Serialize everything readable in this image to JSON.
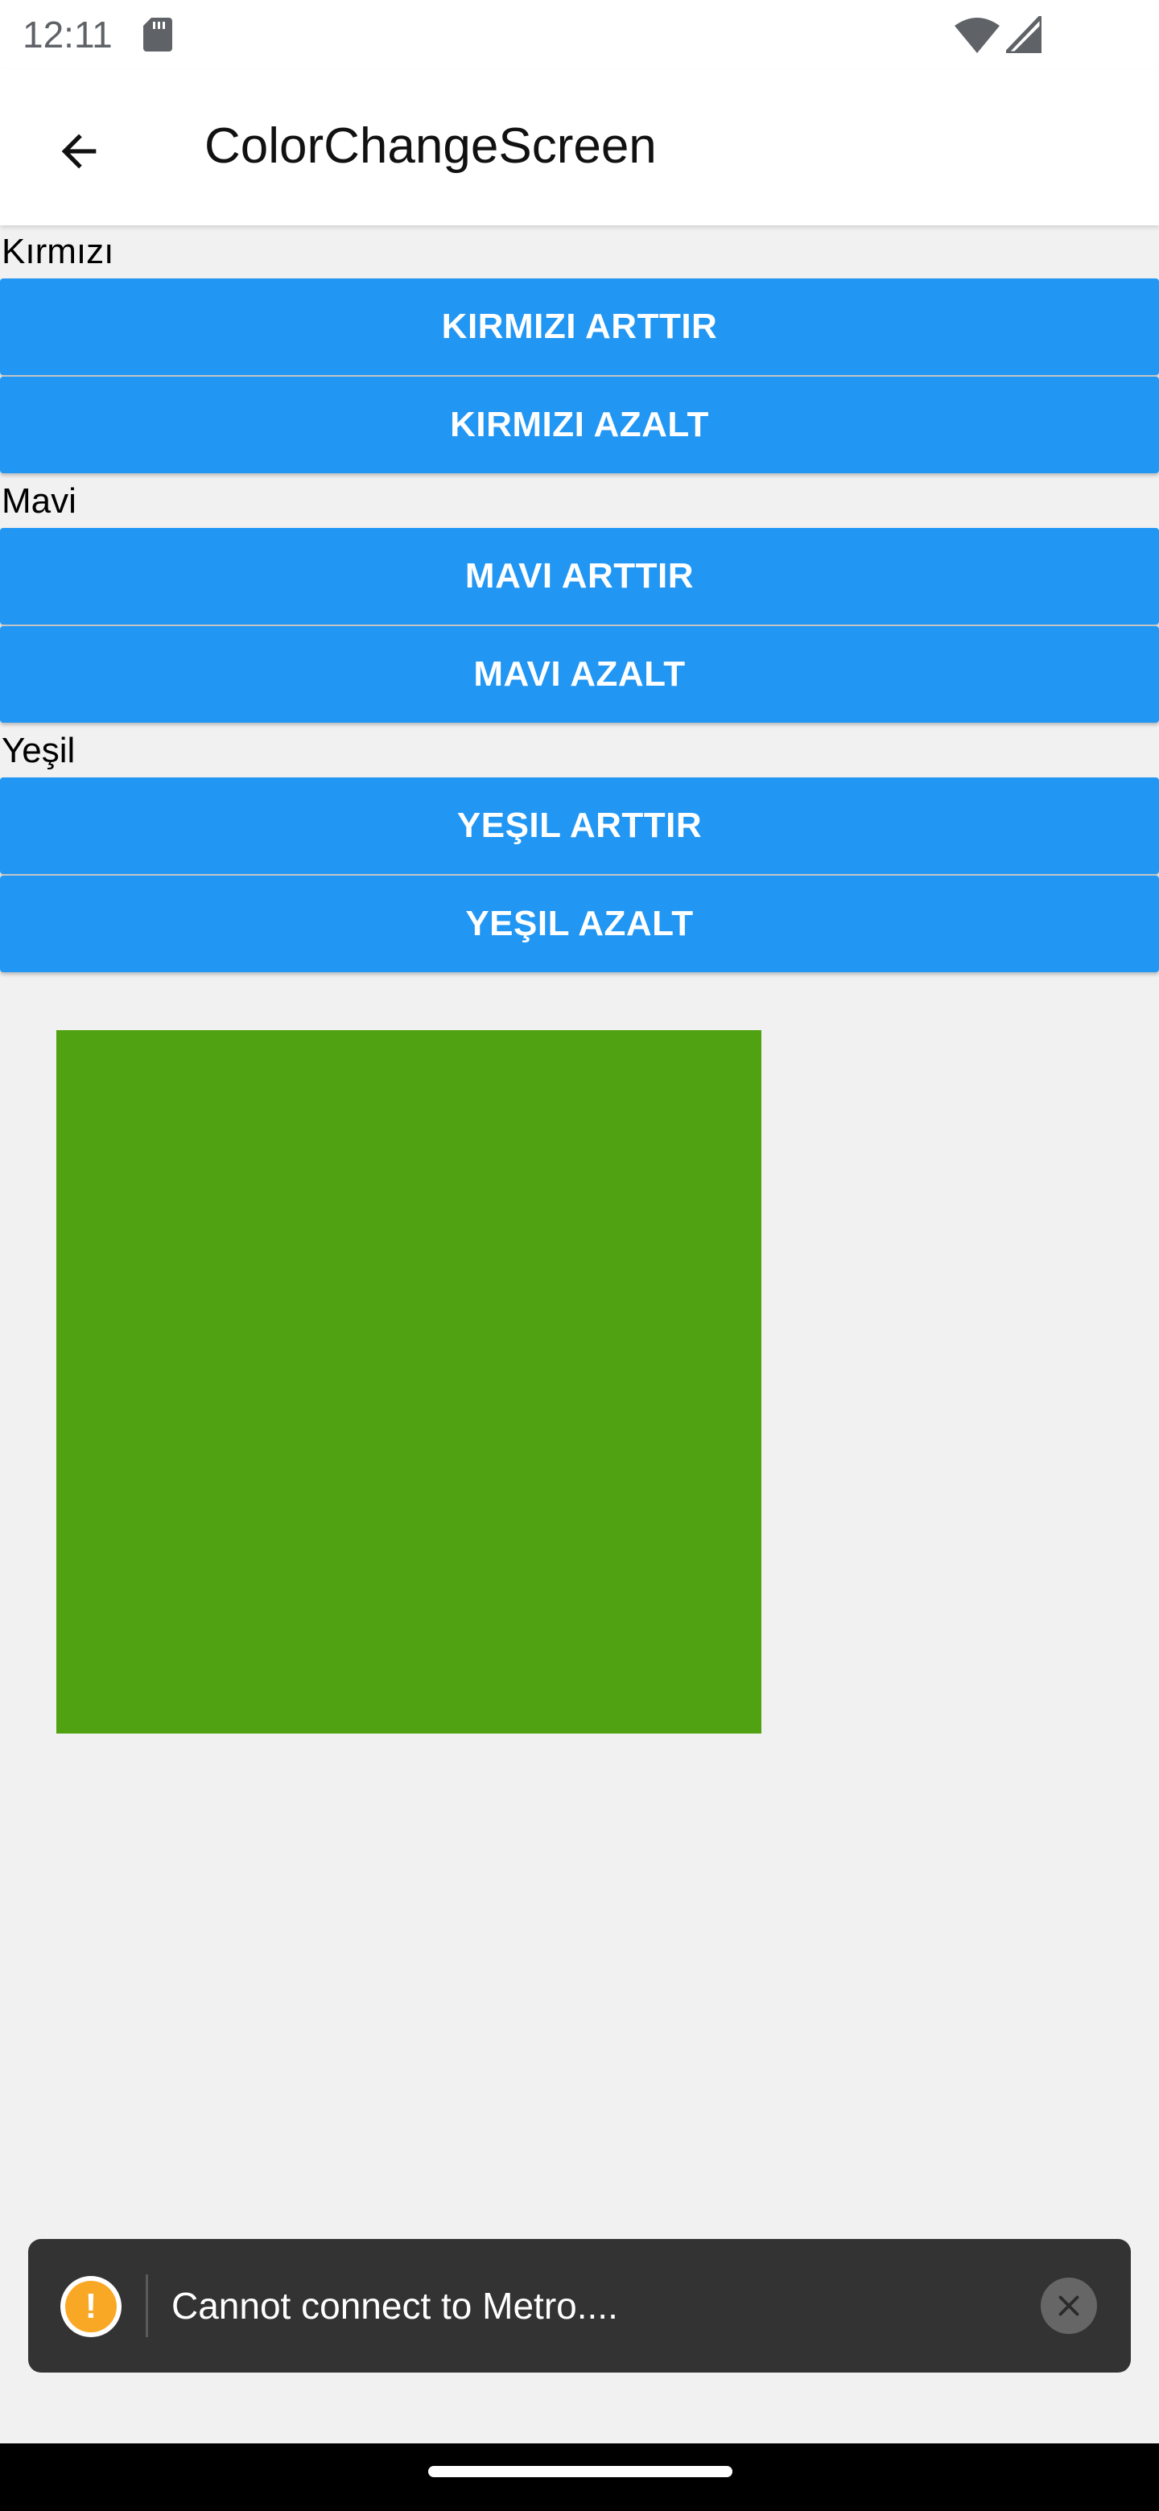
{
  "status_bar": {
    "time": "12:11",
    "icons": [
      "sd-card-icon",
      "wifi-icon",
      "signal-icon"
    ]
  },
  "app_bar": {
    "title": "ColorChangeScreen",
    "back_icon": "arrow-back-icon"
  },
  "sections": [
    {
      "label": "Kırmızı",
      "increase": "KIRMIZI ARTTIR",
      "decrease": "KIRMIZI AZALT"
    },
    {
      "label": "Mavi",
      "increase": "MAVI ARTTIR",
      "decrease": "MAVI AZALT"
    },
    {
      "label": "Yeşil",
      "increase": "YEŞIL ARTTIR",
      "decrease": "YEŞIL AZALT"
    }
  ],
  "color_preview": {
    "color": "#50a213"
  },
  "toast": {
    "message": "Cannot connect to Metro....",
    "icon": "warning-icon",
    "close_icon": "close-icon"
  },
  "colors": {
    "button": "#2196f3",
    "background": "#f1f1f1",
    "toast_bg": "#333333",
    "warning": "#f9a825"
  }
}
